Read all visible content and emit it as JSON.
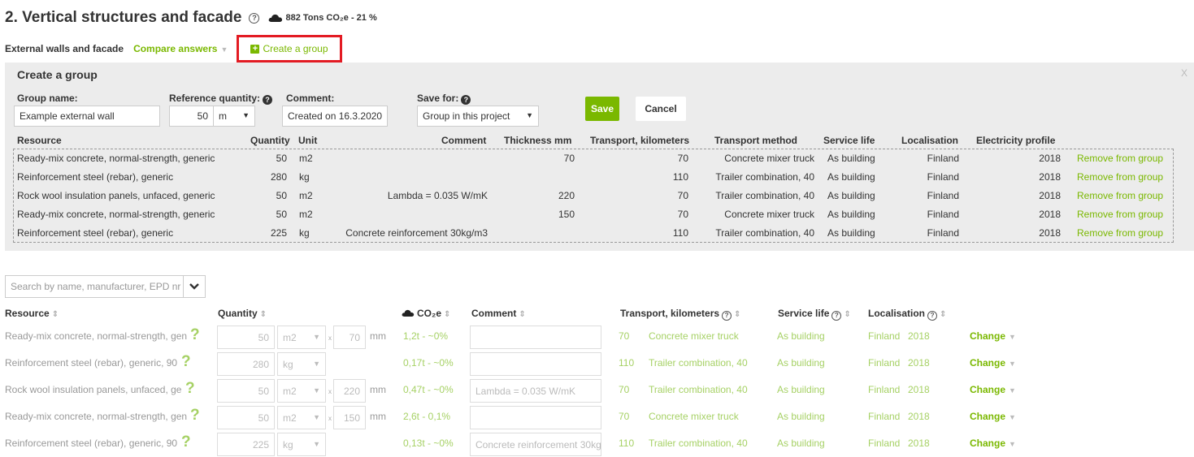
{
  "header": {
    "title": "2. Vertical structures and facade",
    "co2_summary": "882 Tons CO₂e - 21 %",
    "section_label": "External walls and facade",
    "compare_label": "Compare answers",
    "create_group_label": "Create a group"
  },
  "create_group": {
    "title": "Create a group",
    "close": "X",
    "group_name_label": "Group name:",
    "group_name_value": "Example external wall",
    "ref_qty_label": "Reference quantity:",
    "ref_qty_value": "50",
    "ref_qty_unit": "m",
    "comment_label": "Comment:",
    "comment_value": "Created on 16.3.2020",
    "save_for_label": "Save for:",
    "save_for_value": "Group in this project",
    "save_button": "Save",
    "cancel_button": "Cancel",
    "columns": {
      "resource": "Resource",
      "quantity": "Quantity",
      "unit": "Unit",
      "comment": "Comment",
      "thickness": "Thickness mm",
      "transport": "Transport, kilometers",
      "transport_method": "Transport method",
      "service_life": "Service life",
      "localisation": "Localisation",
      "electricity": "Electricity profile"
    },
    "rows": [
      {
        "resource": "Ready-mix concrete, normal-strength, generic",
        "quantity": "50",
        "unit": "m2",
        "comment": "",
        "thickness": "70",
        "transport": "70",
        "method": "Concrete mixer truck",
        "service_life": "As building",
        "localisation": "Finland",
        "electricity": "2018",
        "action": "Remove from group"
      },
      {
        "resource": "Reinforcement steel (rebar), generic",
        "quantity": "280",
        "unit": "kg",
        "comment": "",
        "thickness": "",
        "transport": "110",
        "method": "Trailer combination, 40",
        "service_life": "As building",
        "localisation": "Finland",
        "electricity": "2018",
        "action": "Remove from group"
      },
      {
        "resource": "Rock wool insulation panels, unfaced, generic",
        "quantity": "50",
        "unit": "m2",
        "comment": "Lambda = 0.035 W/mK",
        "thickness": "220",
        "transport": "70",
        "method": "Trailer combination, 40",
        "service_life": "As building",
        "localisation": "Finland",
        "electricity": "2018",
        "action": "Remove from group"
      },
      {
        "resource": "Ready-mix concrete, normal-strength, generic",
        "quantity": "50",
        "unit": "m2",
        "comment": "",
        "thickness": "150",
        "transport": "70",
        "method": "Concrete mixer truck",
        "service_life": "As building",
        "localisation": "Finland",
        "electricity": "2018",
        "action": "Remove from group"
      },
      {
        "resource": "Reinforcement steel (rebar), generic",
        "quantity": "225",
        "unit": "kg",
        "comment": "Concrete reinforcement 30kg/m3",
        "thickness": "",
        "transport": "110",
        "method": "Trailer combination, 40",
        "service_life": "As building",
        "localisation": "Finland",
        "electricity": "2018",
        "action": "Remove from group"
      }
    ]
  },
  "search": {
    "placeholder": "Search by name, manufacturer, EPD nr"
  },
  "table": {
    "columns": {
      "resource": "Resource",
      "quantity": "Quantity",
      "co2": "CO₂e",
      "comment": "Comment",
      "transport": "Transport, kilometers",
      "service_life": "Service life",
      "localisation": "Localisation"
    },
    "rows": [
      {
        "resource": "Ready-mix concrete, normal-strength, gen",
        "quantity": "50",
        "unit": "m2",
        "thickness": "70",
        "thickness_unit": "mm",
        "co2": "1,2t - ~0%",
        "comment": "",
        "transport": "70",
        "method": "Concrete mixer truck",
        "service_life": "As building",
        "localisation": "Finland",
        "year": "2018",
        "change": "Change"
      },
      {
        "resource": "Reinforcement steel (rebar), generic, 90",
        "quantity": "280",
        "unit": "kg",
        "thickness": "",
        "thickness_unit": "",
        "co2": "0,17t - ~0%",
        "comment": "",
        "transport": "110",
        "method": "Trailer combination, 40",
        "service_life": "As building",
        "localisation": "Finland",
        "year": "2018",
        "change": "Change"
      },
      {
        "resource": "Rock wool insulation panels, unfaced, ge",
        "quantity": "50",
        "unit": "m2",
        "thickness": "220",
        "thickness_unit": "mm",
        "co2": "0,47t - ~0%",
        "comment": "Lambda = 0.035 W/mK",
        "transport": "70",
        "method": "Trailer combination, 40",
        "service_life": "As building",
        "localisation": "Finland",
        "year": "2018",
        "change": "Change"
      },
      {
        "resource": "Ready-mix concrete, normal-strength, gen",
        "quantity": "50",
        "unit": "m2",
        "thickness": "150",
        "thickness_unit": "mm",
        "co2": "2,6t - 0,1%",
        "comment": "",
        "transport": "70",
        "method": "Concrete mixer truck",
        "service_life": "As building",
        "localisation": "Finland",
        "year": "2018",
        "change": "Change"
      },
      {
        "resource": "Reinforcement steel (rebar), generic, 90",
        "quantity": "225",
        "unit": "kg",
        "thickness": "",
        "thickness_unit": "",
        "co2": "0,13t - ~0%",
        "comment": "Concrete reinforcement 30kg",
        "transport": "110",
        "method": "Trailer combination, 40",
        "service_life": "As building",
        "localisation": "Finland",
        "year": "2018",
        "change": "Change"
      }
    ]
  },
  "colors": {
    "accent": "#7ab800",
    "highlight_border": "#e31b23",
    "panel_bg": "#ececec"
  }
}
